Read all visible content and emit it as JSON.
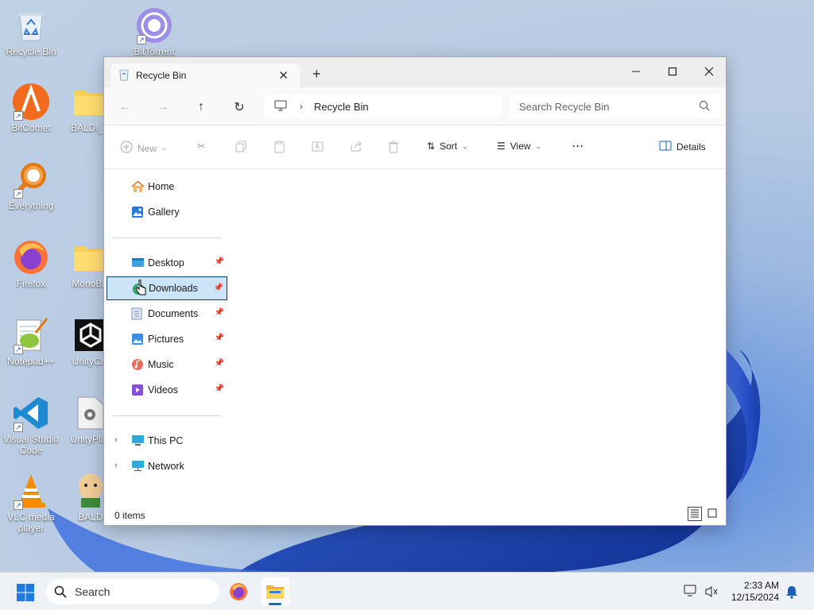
{
  "desktop": {
    "icons": [
      {
        "label": "Recycle Bin",
        "icon": "recycle-bin-icon"
      },
      {
        "label": "BitTorrent",
        "icon": "bittorrent-icon"
      },
      {
        "label": "BitComet",
        "icon": "bitcomet-icon"
      },
      {
        "label": "BALDI_D",
        "icon": "folder-icon"
      },
      {
        "label": "Everything",
        "icon": "everything-search-icon"
      },
      {
        "label": "Firefox",
        "icon": "firefox-icon"
      },
      {
        "label": "MonoBle",
        "icon": "folder-icon"
      },
      {
        "label": "Notepad++",
        "icon": "notepadpp-icon"
      },
      {
        "label": "UnityCra",
        "icon": "unity-icon"
      },
      {
        "label": "Visual Studio Code",
        "icon": "vscode-icon"
      },
      {
        "label": "UnityPlay",
        "icon": "settings-file-icon"
      },
      {
        "label": "VLC media player",
        "icon": "vlc-icon"
      },
      {
        "label": "BALD",
        "icon": "baldi-icon"
      }
    ]
  },
  "window": {
    "tab_title": "Recycle Bin",
    "new_tab_symbol": "+",
    "controls": {
      "minimize": "minimize-icon",
      "maximize": "maximize-icon",
      "close": "close-icon"
    }
  },
  "navigation": {
    "breadcrumb": "Recycle Bin",
    "search_placeholder": "Search Recycle Bin"
  },
  "commandbar": {
    "new_label": "New",
    "sort_label": "Sort",
    "view_label": "View",
    "more_label": "···",
    "details_label": "Details"
  },
  "sidebar": {
    "quick": [
      {
        "label": "Home",
        "icon": "home-icon"
      },
      {
        "label": "Gallery",
        "icon": "gallery-icon"
      }
    ],
    "pinned": [
      {
        "label": "Desktop",
        "icon": "desktop-folder-icon"
      },
      {
        "label": "Downloads",
        "icon": "downloads-folder-icon",
        "selected": true
      },
      {
        "label": "Documents",
        "icon": "documents-folder-icon"
      },
      {
        "label": "Pictures",
        "icon": "pictures-folder-icon"
      },
      {
        "label": "Music",
        "icon": "music-folder-icon"
      },
      {
        "label": "Videos",
        "icon": "videos-folder-icon"
      }
    ],
    "locations": [
      {
        "label": "This PC",
        "icon": "this-pc-icon"
      },
      {
        "label": "Network",
        "icon": "network-icon"
      }
    ]
  },
  "status": {
    "item_count": "0 items"
  },
  "taskbar": {
    "search_label": "Search",
    "time": "2:33 AM",
    "date": "12/15/2024"
  },
  "colors": {
    "accent": "#0f6cbd",
    "selection_bg": "#cce4f7",
    "selection_border": "#0f3d70",
    "title_bg": "#eeeeee"
  }
}
